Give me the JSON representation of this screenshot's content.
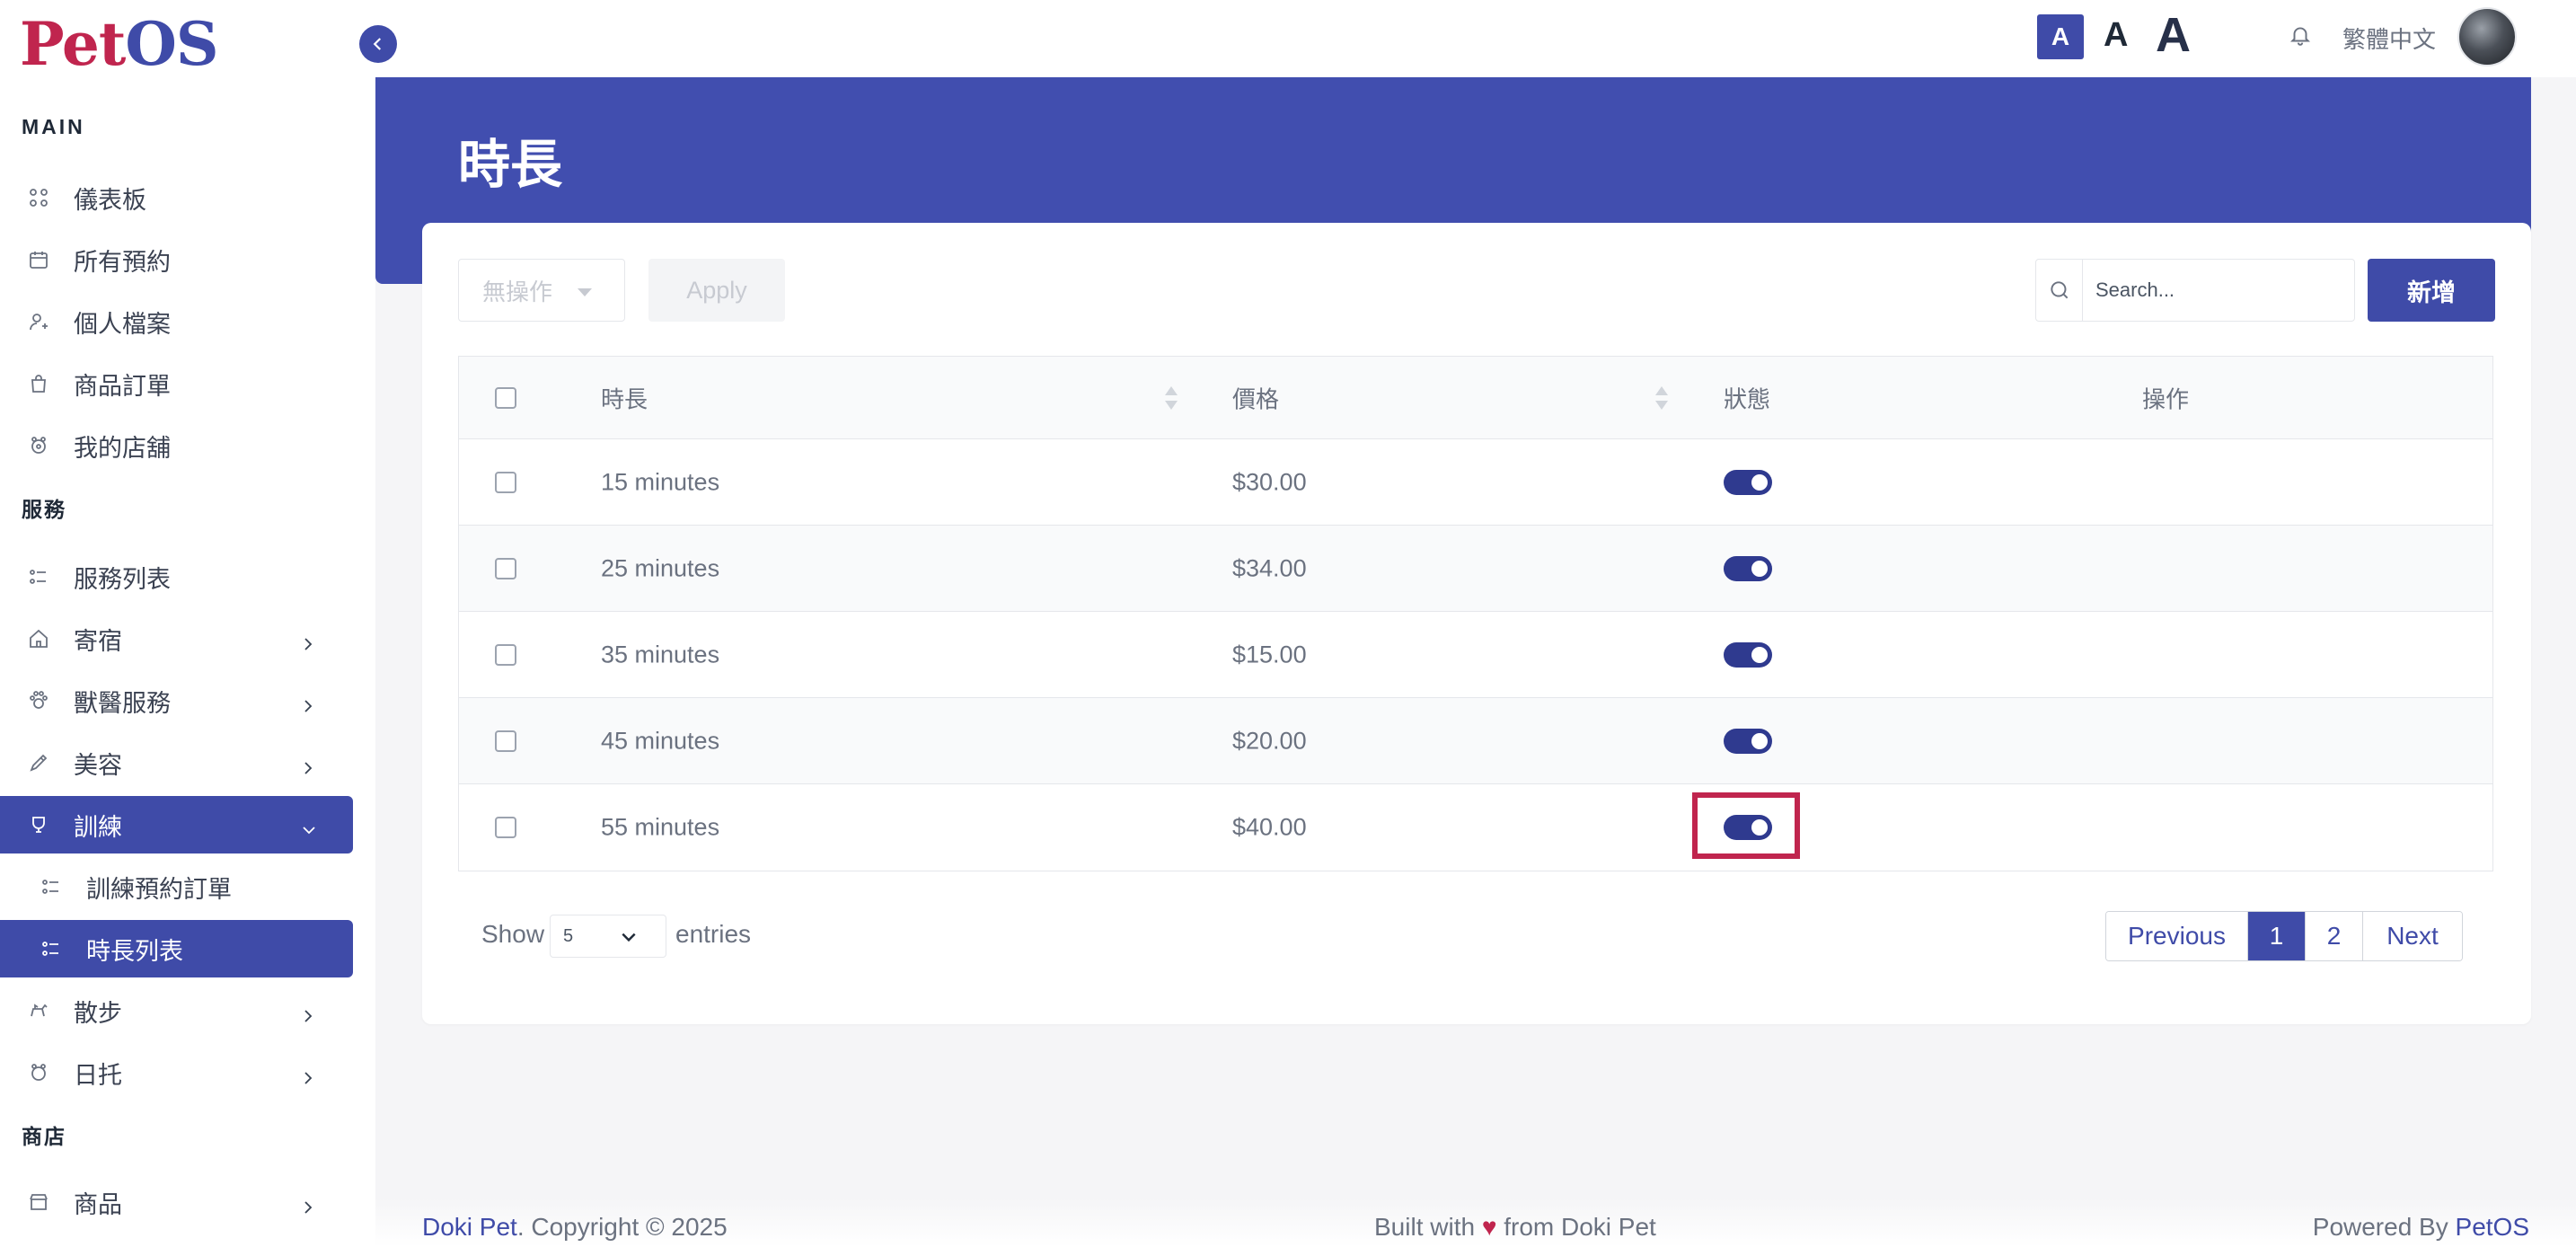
{
  "brand": {
    "logo_part1": "Pet",
    "logo_part2": "OS"
  },
  "sidebar": {
    "section_main": "MAIN",
    "section_services": "服務",
    "section_shop": "商店",
    "items": [
      {
        "label": "儀表板",
        "icon": "dashboard-icon"
      },
      {
        "label": "所有預約",
        "icon": "calendar-icon"
      },
      {
        "label": "個人檔案",
        "icon": "user-icon"
      },
      {
        "label": "商品訂單",
        "icon": "bag-icon"
      },
      {
        "label": "我的店舖",
        "icon": "store-icon"
      },
      {
        "label": "服務列表",
        "icon": "list-icon"
      },
      {
        "label": "寄宿",
        "icon": "home-icon"
      },
      {
        "label": "獸醫服務",
        "icon": "paw-icon"
      },
      {
        "label": "美容",
        "icon": "brush-icon"
      },
      {
        "label": "訓練",
        "icon": "training-icon"
      },
      {
        "label": "訓練預約訂單",
        "icon": "list-icon"
      },
      {
        "label": "時長列表",
        "icon": "list-icon"
      },
      {
        "label": "散步",
        "icon": "dog-icon"
      },
      {
        "label": "日托",
        "icon": "daycare-icon"
      },
      {
        "label": "商品",
        "icon": "shop-icon"
      }
    ]
  },
  "topbar": {
    "font_small": "A",
    "font_mid": "A",
    "font_big": "A",
    "language": "繁體中文"
  },
  "page": {
    "title": "時長"
  },
  "toolbar": {
    "bulk_action": "無操作",
    "apply_label": "Apply",
    "search_placeholder": "Search...",
    "add_label": "新增"
  },
  "table": {
    "headers": {
      "duration": "時長",
      "price": "價格",
      "status": "狀態",
      "actions": "操作"
    },
    "rows": [
      {
        "duration": "15 minutes",
        "price": "$30.00",
        "enabled": true
      },
      {
        "duration": "25 minutes",
        "price": "$34.00",
        "enabled": true
      },
      {
        "duration": "35 minutes",
        "price": "$15.00",
        "enabled": true
      },
      {
        "duration": "45 minutes",
        "price": "$20.00",
        "enabled": true
      },
      {
        "duration": "55 minutes",
        "price": "$40.00",
        "enabled": true
      }
    ]
  },
  "pagination": {
    "show_label": "Show",
    "page_size": "5",
    "entries_label": "entries",
    "previous": "Previous",
    "page1": "1",
    "page2": "2",
    "next": "Next"
  },
  "footer": {
    "brand": "Doki Pet",
    "copyright": ". Copyright © 2025",
    "built_with": "Built with",
    "heart": "♥",
    "from": "from Doki Pet",
    "powered_by": "Powered By",
    "powered_brand": "PetOS"
  },
  "colors": {
    "accent": "#3f4ba8",
    "brand_red": "#c0254e",
    "band": "#414eaf"
  }
}
